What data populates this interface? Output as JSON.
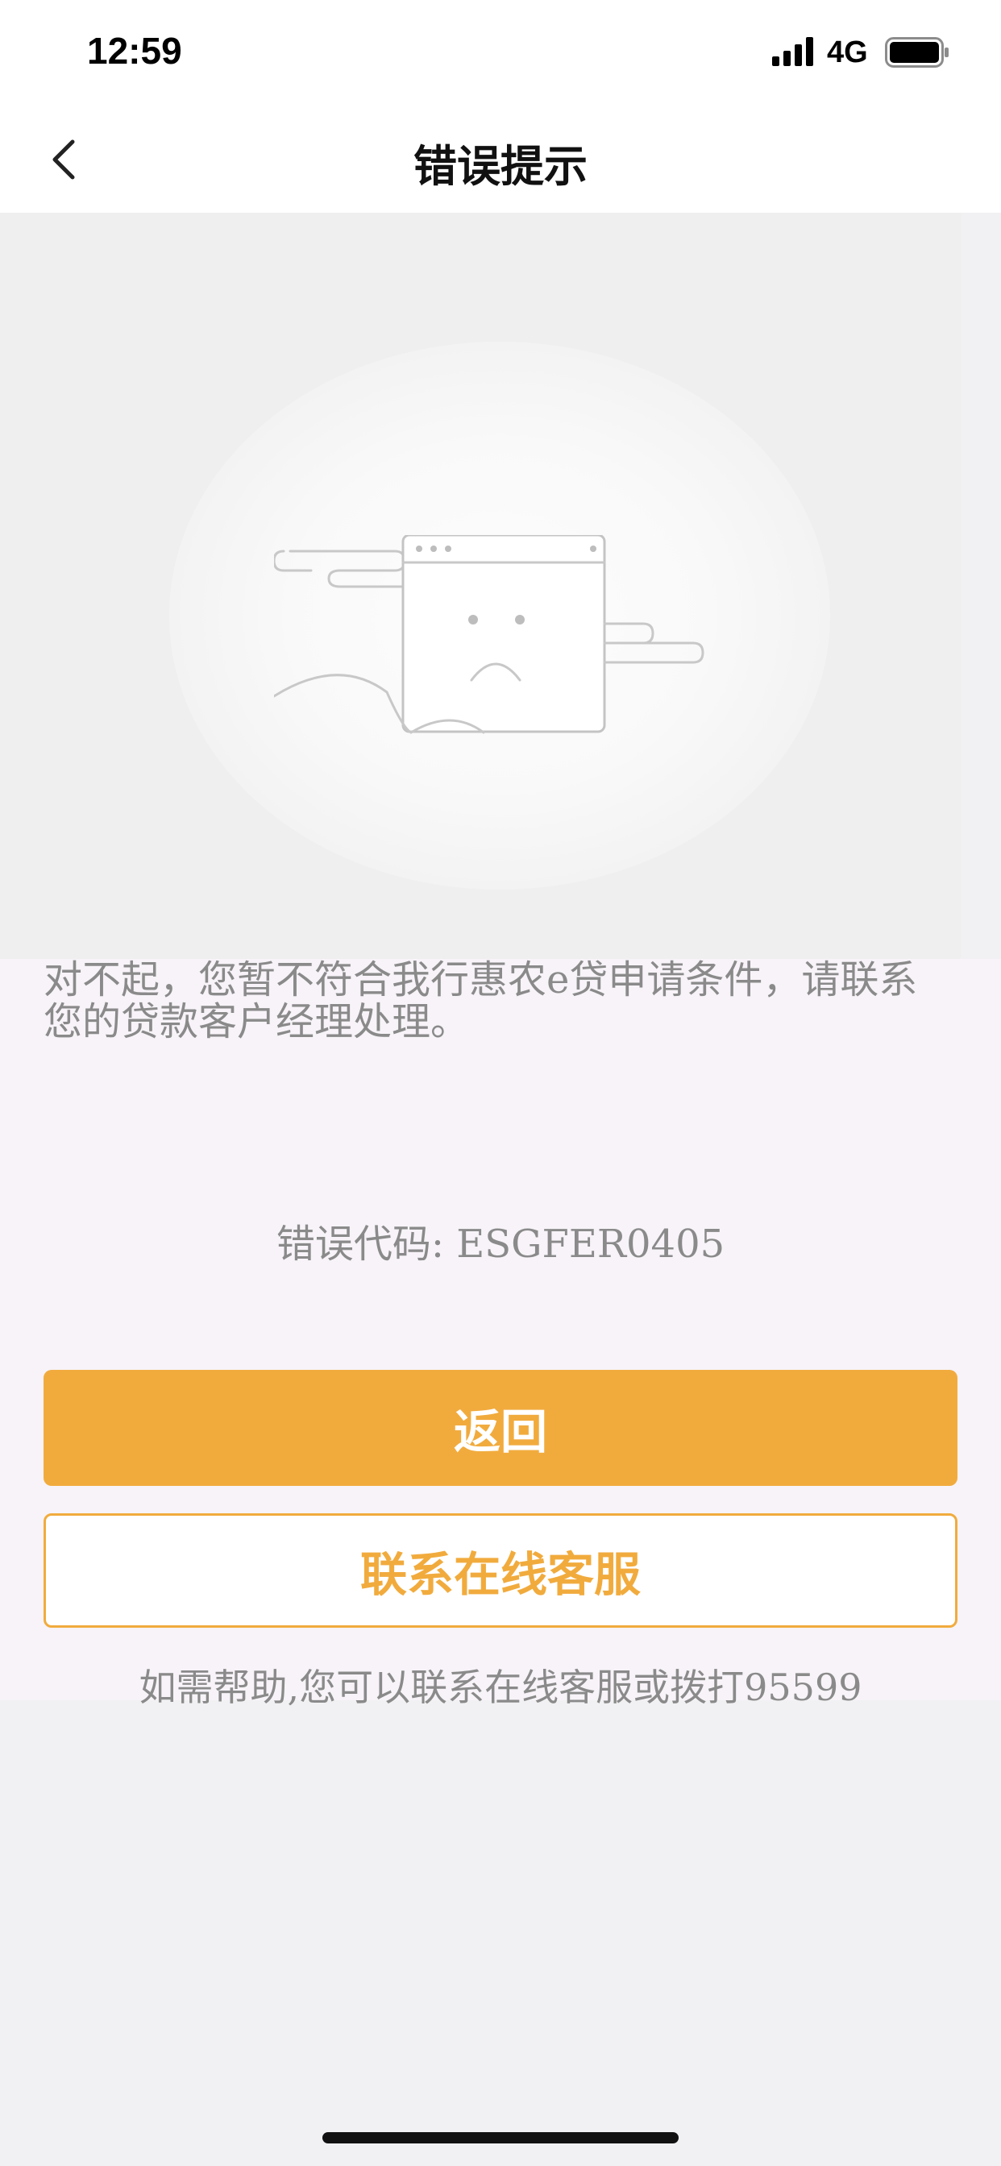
{
  "status_bar": {
    "time": "12:59",
    "network": "4G",
    "icons": [
      "signal-icon",
      "battery-icon"
    ]
  },
  "nav": {
    "title": "错误提示",
    "back_icon": "chevron-left-icon"
  },
  "illustration": {
    "icon": "sad-window-icon"
  },
  "content": {
    "message": "对不起，您暂不符合我行惠农e贷申请条件，请联系您的贷款客户经理处理。",
    "error_code": "错误代码: ESGFER0405",
    "return_button": "返回",
    "service_button": "联系在线客服",
    "help_text": "如需帮助,您可以联系在线客服或拨打95599"
  },
  "colors": {
    "accent": "#f1ab3d",
    "text_muted": "#8a8a8a",
    "page_bg": "#f1f0f2"
  }
}
